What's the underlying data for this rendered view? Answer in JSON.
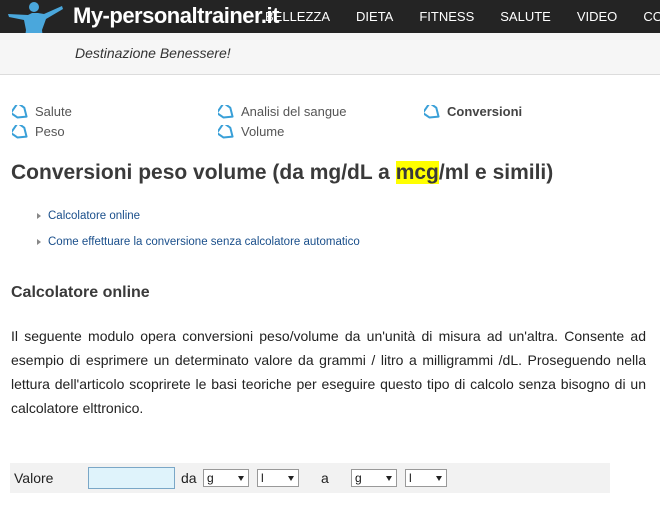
{
  "header": {
    "logo_text": "My-personaltrainer.it",
    "nav": [
      "BELLEZZA",
      "DIETA",
      "FITNESS",
      "SALUTE",
      "VIDEO",
      "CO"
    ],
    "tagline": "Destinazione Benessere!"
  },
  "tags": {
    "salute": "Salute",
    "analisi": "Analisi del sangue",
    "conversioni": "Conversioni",
    "peso": "Peso",
    "volume": "Volume"
  },
  "title": {
    "before": "Conversioni peso volume (da mg/dL a ",
    "highlight": "mcg",
    "after": "/ml e simili)"
  },
  "toc": [
    "Calcolatore online",
    "Come effettuare la conversione senza calcolatore automatico"
  ],
  "section_title": "Calcolatore online",
  "paragraph": "Il seguente modulo opera conversioni peso/volume da un'unità di misura ad un'altra. Consente ad esempio di esprimere un determinato valore da grammi / litro a milligrammi /dL. Proseguendo nella lettura dell'articolo scoprirete le basi teoriche per eseguire questo tipo di calcolo senza bisogno di un calcolatore elttronico.",
  "converter": {
    "label": "Valore",
    "value": "",
    "from_label": "da",
    "from_weight": "g",
    "from_volume": "l",
    "to_label": "a",
    "to_weight": "g",
    "to_volume": "l"
  },
  "colors": {
    "topbar": "#242424",
    "link": "#1a4f8b",
    "highlight": "#ffff00",
    "tag_icon": "#3aa0d8"
  }
}
